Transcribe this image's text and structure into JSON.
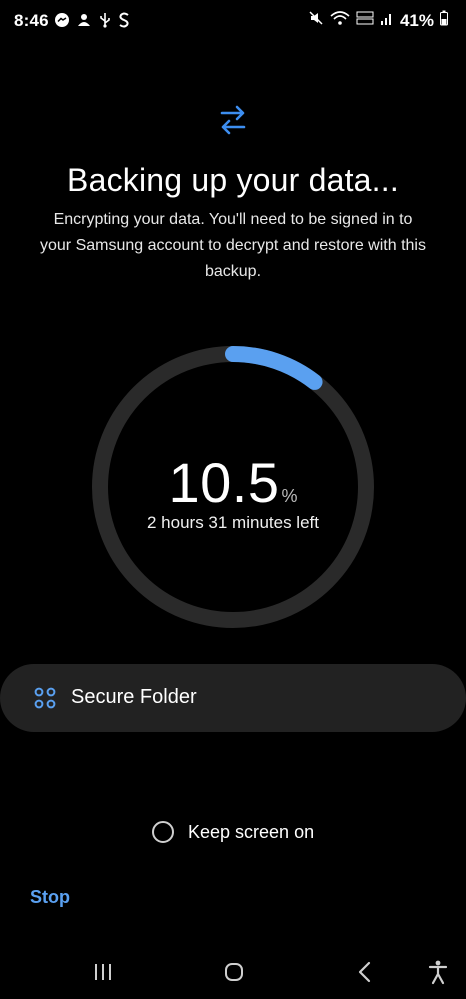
{
  "status_bar": {
    "time": "8:46",
    "left_icons": [
      "messenger-icon",
      "app-notification-icon",
      "usb-icon",
      "s-app-icon"
    ],
    "right_icons": [
      "mute-icon",
      "wifi-6-icon",
      "volte-lte-icon",
      "signal-icon",
      "battery-icon"
    ],
    "battery_percent": "41%"
  },
  "header": {
    "icon": "sync-arrows-icon",
    "title": "Backing up your data...",
    "subtitle": "Encrypting your data. You'll need to be signed in to your Samsung account to decrypt and restore with this backup."
  },
  "progress": {
    "value": "10.5",
    "unit": "%",
    "fraction": 0.105,
    "time_left": "2 hours 31 minutes left",
    "accent_color": "#5aa0f0",
    "track_color": "#2a2a2a"
  },
  "secure_folder": {
    "label": "Secure Folder",
    "icon": "secure-folder-icon"
  },
  "keep_screen_on": {
    "label": "Keep screen on",
    "checked": false
  },
  "actions": {
    "stop_label": "Stop"
  },
  "nav_bar": {
    "items": [
      "recents-icon",
      "home-icon",
      "back-icon",
      "accessibility-icon"
    ]
  }
}
